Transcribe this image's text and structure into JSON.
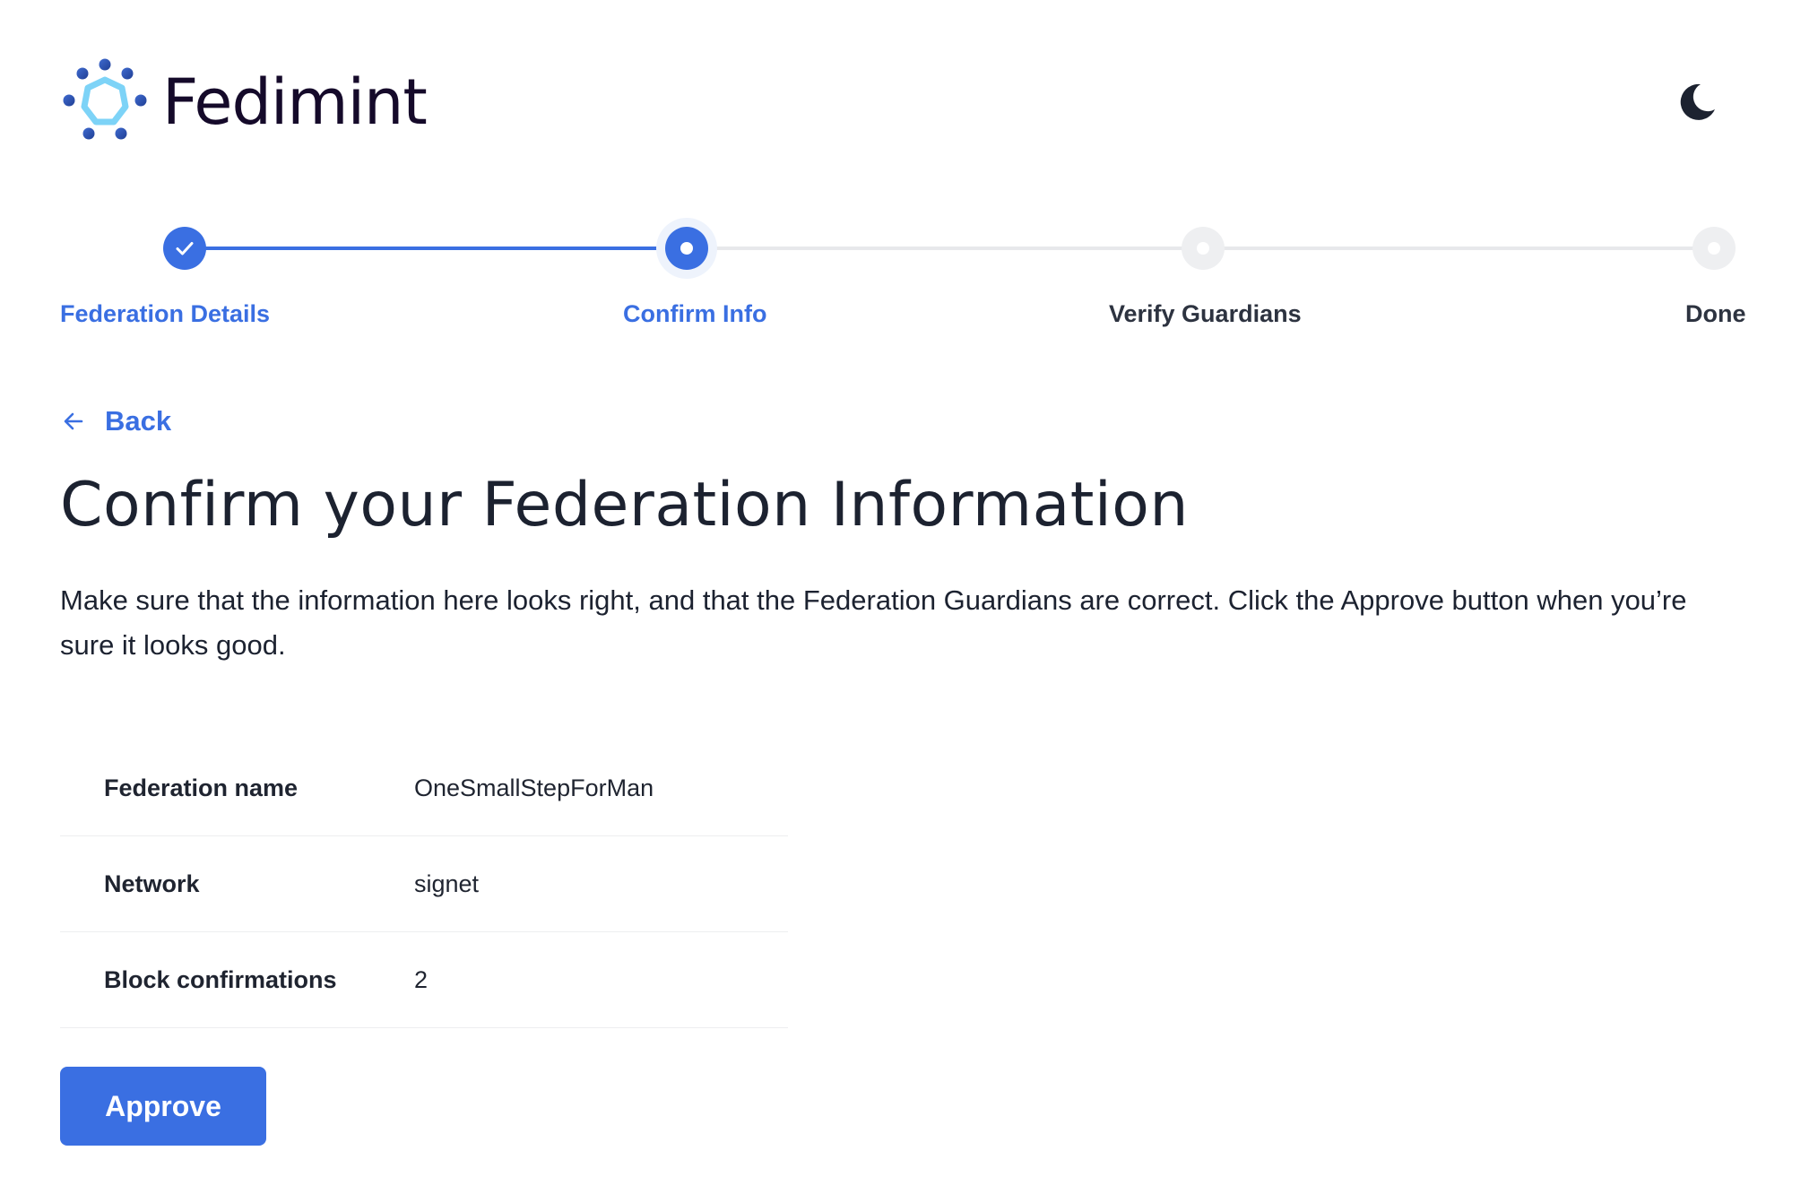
{
  "header": {
    "brand_name": "Fedimint",
    "logo_icon": "fedimint-logo-icon",
    "theme_toggle_icon": "moon-icon"
  },
  "stepper": {
    "steps": [
      {
        "label": "Federation Details",
        "state": "completed"
      },
      {
        "label": "Confirm Info",
        "state": "active"
      },
      {
        "label": "Verify Guardians",
        "state": "pending"
      },
      {
        "label": "Done",
        "state": "pending"
      }
    ]
  },
  "nav": {
    "back_label": "Back"
  },
  "main": {
    "title": "Confirm your Federation Information",
    "description": "Make sure that the information here looks right, and that the Federation Guardians are correct. Click the Approve button when you’re sure it looks good.",
    "info_rows": [
      {
        "key": "Federation name",
        "value": "OneSmallStepForMan"
      },
      {
        "key": "Network",
        "value": "signet"
      },
      {
        "key": "Block confirmations",
        "value": "2"
      }
    ],
    "approve_label": "Approve"
  },
  "colors": {
    "accent": "#3a6fe2",
    "brand_text": "#150a2a",
    "logo_light": "#7dd3f7",
    "logo_dark": "#2d4fa8",
    "inactive_track": "#e7e8eb"
  }
}
